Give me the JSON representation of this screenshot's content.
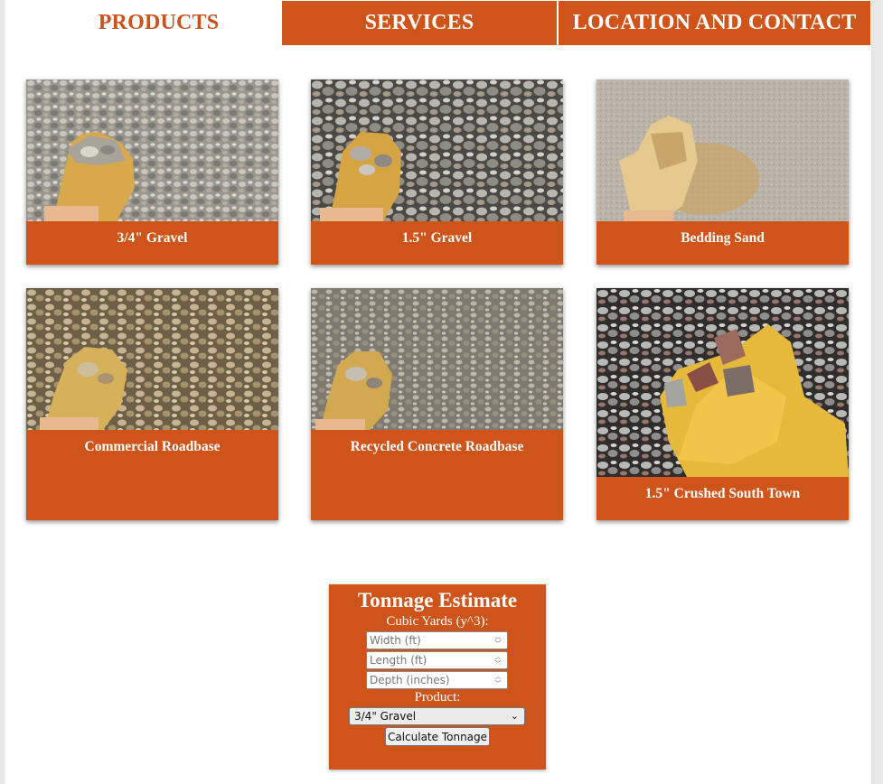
{
  "nav": {
    "tabs": [
      {
        "label": "PRODUCTS",
        "active": true
      },
      {
        "label": "SERVICES",
        "active": false
      },
      {
        "label": "LOCATION AND CONTACT",
        "active": false
      }
    ]
  },
  "products": [
    {
      "name": "3/4\" Gravel"
    },
    {
      "name": "1.5\" Gravel"
    },
    {
      "name": "Bedding Sand"
    },
    {
      "name": "Commercial Roadbase"
    },
    {
      "name": "Recycled Concrete Roadbase"
    },
    {
      "name": "1.5\" Crushed South Town"
    }
  ],
  "calculator": {
    "title": "Tonnage Estimate",
    "cubic_yards_label": "Cubic Yards (y^3):",
    "width_placeholder": "Width (ft)",
    "length_placeholder": "Length (ft)",
    "depth_placeholder": "Depth (inches)",
    "product_label": "Product:",
    "selected_product": "3/4\" Gravel",
    "button_label": "Calculate Tonnage"
  },
  "colors": {
    "brand_orange": "#cf5419",
    "active_tab_text": "#c8531b"
  }
}
